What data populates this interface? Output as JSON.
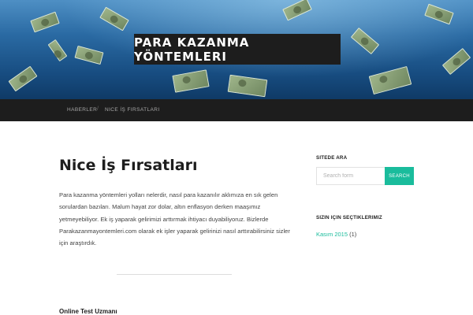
{
  "site": {
    "title": "PARA KAZANMA YÖNTEMLERI"
  },
  "nav": {
    "items": [
      "HABERLER",
      "NICE İŞ FIRSATLARI"
    ],
    "separator": "/"
  },
  "post": {
    "title": "Nice İş Fırsatları",
    "body": "Para kazanma yöntemleri yolları nelerdir, nasıl para kazanılır aklımıza en sık gelen sorulardan bazıları. Malum hayat zor dolar, altın enflasyon derken maaşımız yetmeyebiliyor. Ek iş yaparak gelirimizi arttırmak ihtiyacı duyabiliyoruz. Bizlerde Parakazanmayontemleri.com olarak ek işler yaparak gelirinizi nasıl arttırabilirsiniz sizler için araştırdık.",
    "next_title": "Online Test Uzmanı"
  },
  "sidebar": {
    "search_title": "SITEDE ARA",
    "search_placeholder": "Search form",
    "search_button": "SEARCH",
    "picks_title": "SIZIN IÇIN SEÇTIKLERIMIZ",
    "archive_link": "Kasım 2015",
    "archive_count": "(1)"
  },
  "colors": {
    "accent": "#1abc9c",
    "header_dark": "#1d1d1d",
    "nav_text": "#a8a8a8"
  }
}
